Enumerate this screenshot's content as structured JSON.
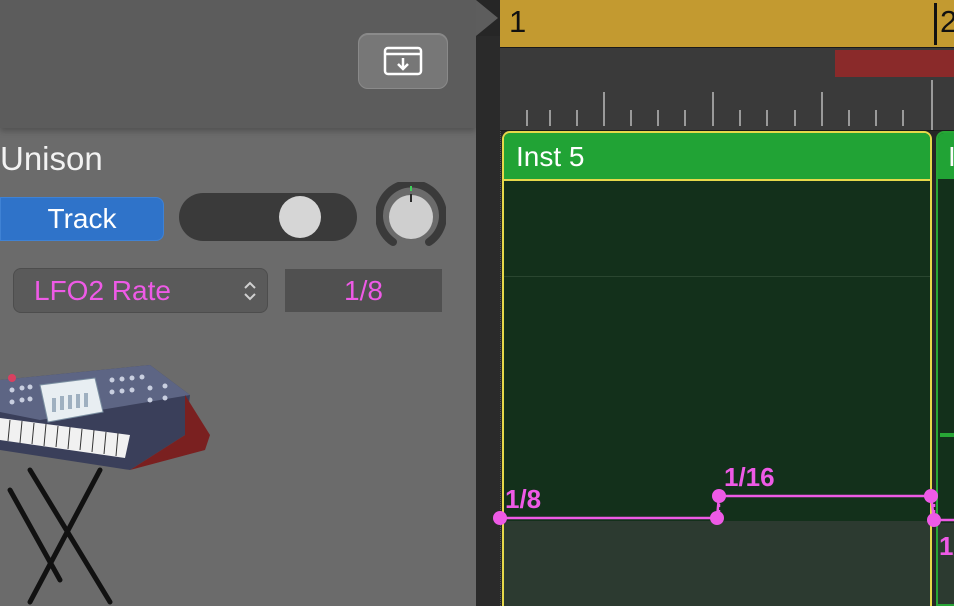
{
  "inspector": {
    "section_title": "Unison",
    "track_button_label": "Track",
    "parameter_select_label": "LFO2 Rate",
    "parameter_value": "1/8",
    "toggle_state": "on"
  },
  "timeline": {
    "bar_numbers": [
      "1",
      "2"
    ],
    "region_name": "Inst 5",
    "region2_name": "I",
    "automation_points": [
      "1/8",
      "1/16",
      "1/"
    ]
  },
  "colors": {
    "cycle": "#c39a30",
    "region_header": "#21a335",
    "region_body": "#13301b",
    "automation": "#ee5ae6",
    "track_button": "#2f73c9"
  },
  "icons": {
    "header_button": "download-to-tray-icon",
    "select_chevron": "up-down-chevron-icon",
    "knob": "rotary-knob-icon"
  }
}
